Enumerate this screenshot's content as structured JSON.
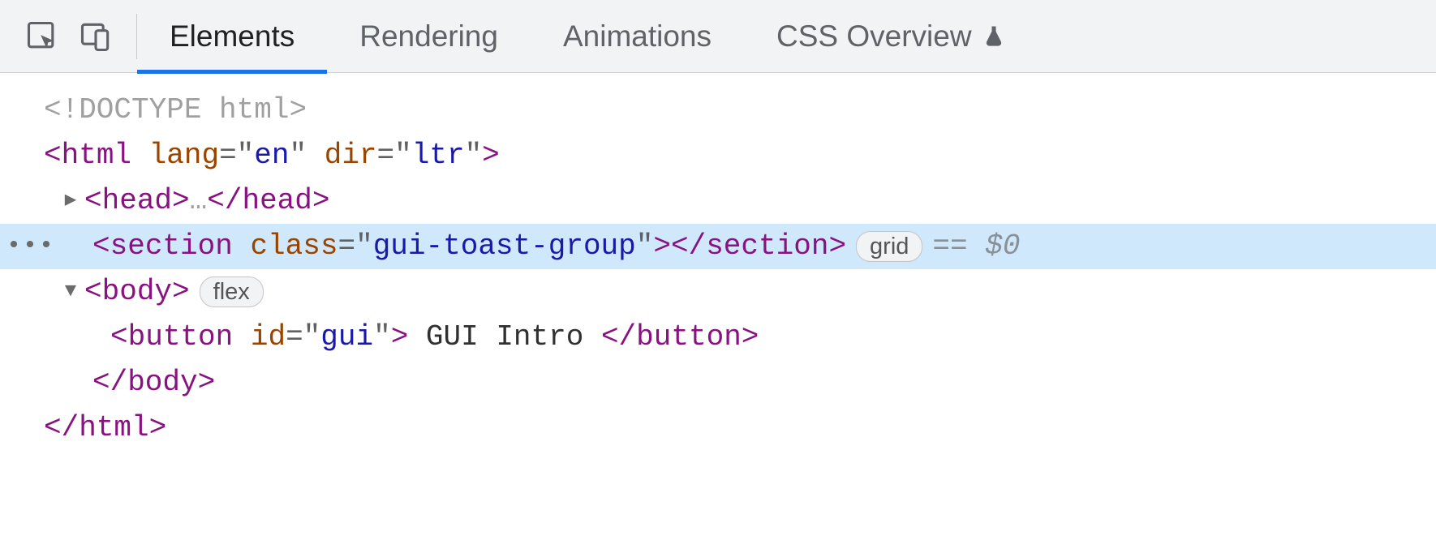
{
  "toolbar": {
    "tabs": [
      "Elements",
      "Rendering",
      "Animations",
      "CSS Overview"
    ],
    "active_tab": 0
  },
  "dom": {
    "doctype": "<!DOCTYPE html>",
    "html_open": {
      "tag": "html",
      "attrs": [
        [
          "lang",
          "en"
        ],
        [
          "dir",
          "ltr"
        ]
      ]
    },
    "head": {
      "tag": "head",
      "collapsed_text": "…"
    },
    "section": {
      "tag": "section",
      "attrs": [
        [
          "class",
          "gui-toast-group"
        ]
      ],
      "badge": "grid",
      "suffix": "== $0"
    },
    "body": {
      "tag": "body",
      "badge": "flex"
    },
    "button": {
      "tag": "button",
      "attrs": [
        [
          "id",
          "gui"
        ]
      ],
      "text": " GUI Intro "
    },
    "body_close": "</body>",
    "html_close": "</html>"
  }
}
